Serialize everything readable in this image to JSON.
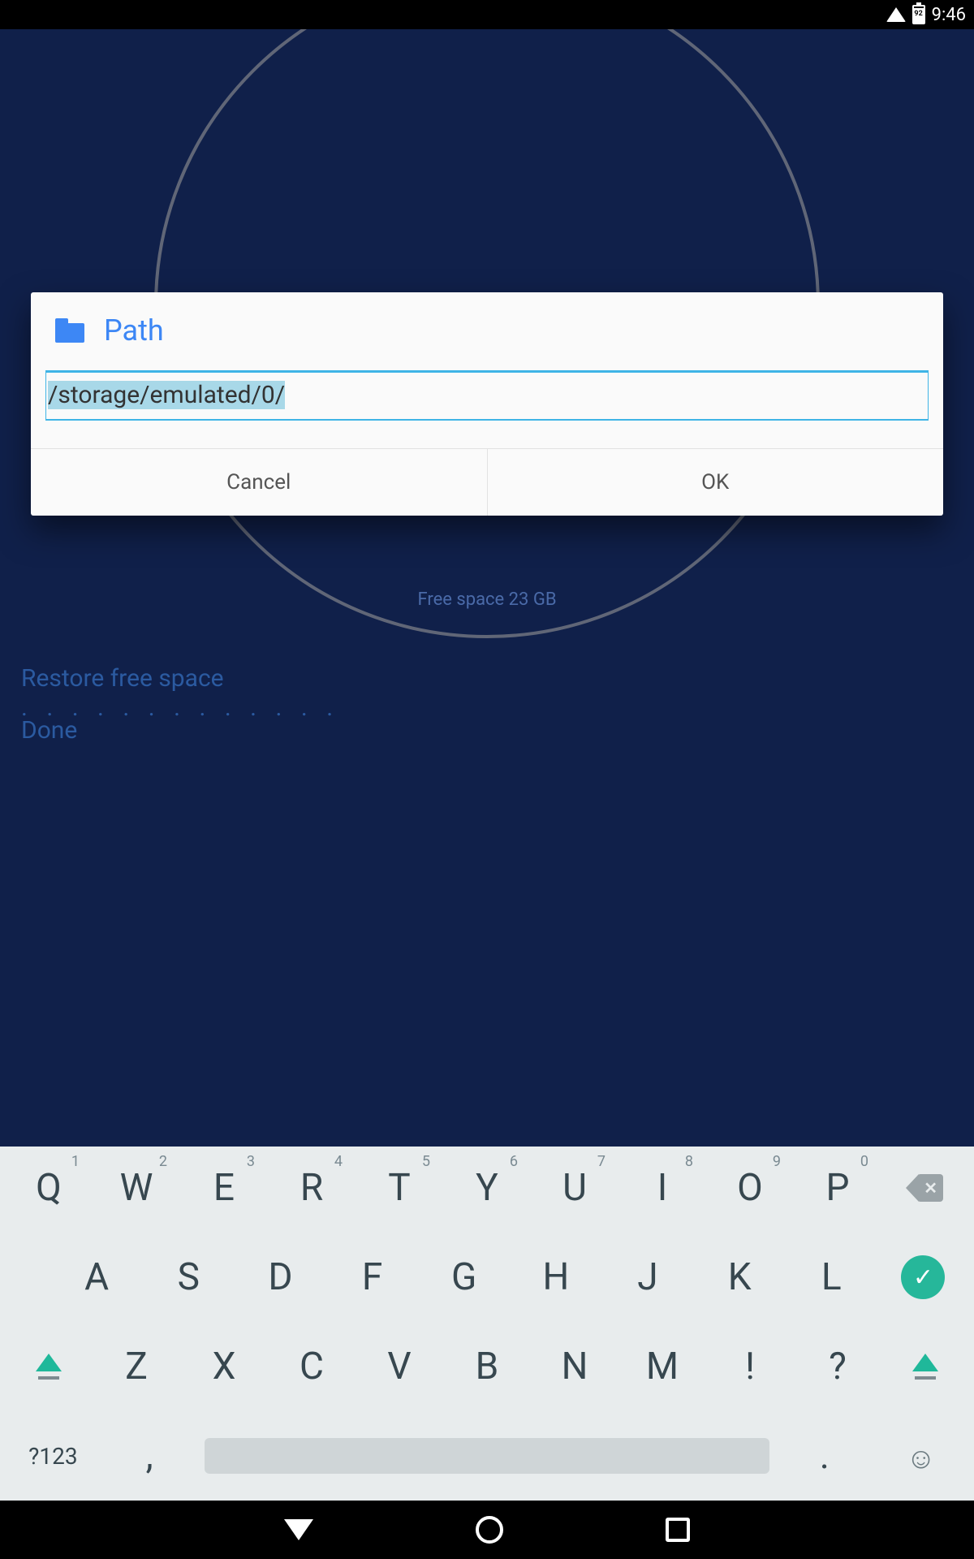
{
  "status": {
    "battery": "92",
    "time": "9:46"
  },
  "background": {
    "free_space": "Free space 23 GB",
    "restore": "Restore free space",
    "dots": ". . . . . . . . . . . . .",
    "done": "Done"
  },
  "dialog": {
    "title": "Path",
    "input_value": "/storage/emulated/0/",
    "cancel": "Cancel",
    "ok": "OK"
  },
  "keyboard": {
    "row1": [
      {
        "k": "Q",
        "h": "1"
      },
      {
        "k": "W",
        "h": "2"
      },
      {
        "k": "E",
        "h": "3"
      },
      {
        "k": "R",
        "h": "4"
      },
      {
        "k": "T",
        "h": "5"
      },
      {
        "k": "Y",
        "h": "6"
      },
      {
        "k": "U",
        "h": "7"
      },
      {
        "k": "I",
        "h": "8"
      },
      {
        "k": "O",
        "h": "9"
      },
      {
        "k": "P",
        "h": "0"
      }
    ],
    "row2": [
      "A",
      "S",
      "D",
      "F",
      "G",
      "H",
      "J",
      "K",
      "L"
    ],
    "row3": [
      "Z",
      "X",
      "C",
      "V",
      "B",
      "N",
      "M",
      "!",
      "?"
    ],
    "symkey": "?123",
    "comma": ",",
    "period": "."
  }
}
